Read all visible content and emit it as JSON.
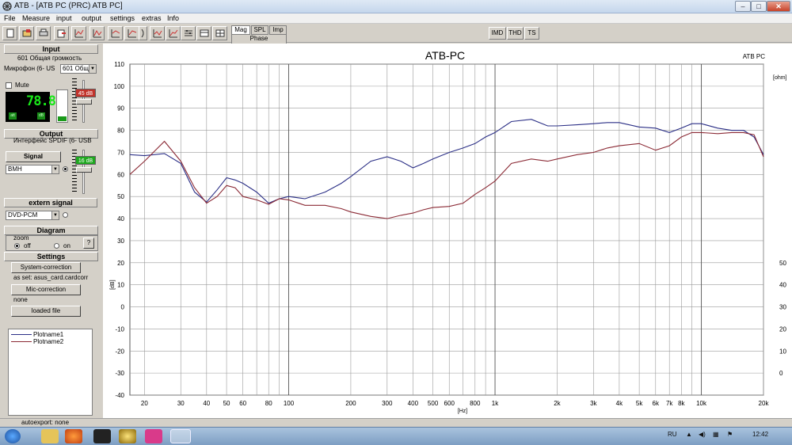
{
  "window": {
    "title": "ATB - [ATB PC (PRC)  ATB PC]",
    "buttons": {
      "minimize": "–",
      "maximize": "□",
      "close": "✕"
    }
  },
  "menu": {
    "items": [
      "File",
      "Measure",
      "input",
      "output",
      "settings",
      "extras",
      "Info"
    ]
  },
  "toolbar": {
    "icons": [
      "new-file-icon",
      "open-file-icon",
      "print-icon",
      "export-icon",
      "response-icon",
      "response-zoom-icon",
      "response-compare-icon",
      "response-overlay-icon",
      "phase-icon",
      "response-alt-icon",
      "response-extra-icon",
      "equalizer-icon",
      "settings-panel-icon",
      "grid-icon"
    ],
    "view_tabs": {
      "mag": "Mag",
      "spl": "SPL",
      "imp": "Imp",
      "phase": "Phase"
    },
    "right_buttons": {
      "imd": "IMD",
      "thd": "THD",
      "ts": "TS"
    }
  },
  "input": {
    "header": "Input",
    "device_name": "601 Общая громкость",
    "mic_label": "Микрофон (6- US",
    "combo": "601 Общ",
    "mute_label": "Mute",
    "level": "78.8",
    "gain": "45 dB",
    "lcd_left": "att",
    "lcd_right": "dB"
  },
  "output": {
    "header": "Output",
    "device_name": "Интерфейс SPDIF (6- USB",
    "level": "16 dB"
  },
  "signal": {
    "header": "Signal",
    "selected": "BMH"
  },
  "extern_signal": {
    "header": "extern signal",
    "selected": "DVD-PCM"
  },
  "diagram": {
    "header": "Diagram",
    "zoom_label": "zoom",
    "off_label": "off",
    "on_label": "on",
    "help_label": "?"
  },
  "settings": {
    "header": "Settings",
    "system_correction": "System-correction",
    "as_set": "as set: asus_card.cardcorr",
    "mic_correction": "Mic-correction",
    "mic_value": "none",
    "loaded_file": "loaded file"
  },
  "legend": [
    {
      "name": "Plotname1",
      "color": "#2b2f86"
    },
    {
      "name": "Plotname2",
      "color": "#8b2a35"
    }
  ],
  "status": {
    "text": "autoexport: none"
  },
  "taskbar": {
    "apps": [
      "start-orb-icon",
      "explorer-icon",
      "firefox-icon",
      "app-icon",
      "app2-icon",
      "app3-icon",
      "atb-icon"
    ],
    "lang": "RU",
    "time": "12:42"
  },
  "chart_data": {
    "type": "line",
    "title": "ATB-PC",
    "top_right_label": "ATB PC",
    "xlabel": "[Hz]",
    "ylabel": "[dB]",
    "y2label": "[ohm]",
    "x_scale": "log",
    "xlim": [
      17,
      20000
    ],
    "ylim": [
      -40,
      110
    ],
    "grid": true,
    "y_ticks": [
      110,
      100,
      90,
      80,
      70,
      60,
      50,
      40,
      30,
      20,
      10,
      0,
      -10,
      -20,
      -30,
      -40
    ],
    "y2_ticks": [
      50,
      40,
      30,
      20,
      10,
      0
    ],
    "y2_tick_values": [
      50,
      40,
      30,
      20,
      10,
      0
    ],
    "x_tick_labels": [
      {
        "x": 20,
        "label": "20"
      },
      {
        "x": 30,
        "label": "30"
      },
      {
        "x": 40,
        "label": "40"
      },
      {
        "x": 50,
        "label": "50"
      },
      {
        "x": 60,
        "label": "60"
      },
      {
        "x": 80,
        "label": "80"
      },
      {
        "x": 100,
        "label": "100"
      },
      {
        "x": 200,
        "label": "200"
      },
      {
        "x": 300,
        "label": "300"
      },
      {
        "x": 400,
        "label": "400"
      },
      {
        "x": 500,
        "label": "500"
      },
      {
        "x": 600,
        "label": "600"
      },
      {
        "x": 800,
        "label": "800"
      },
      {
        "x": 1000,
        "label": "1k"
      },
      {
        "x": 2000,
        "label": "2k"
      },
      {
        "x": 3000,
        "label": "3k"
      },
      {
        "x": 4000,
        "label": "4k"
      },
      {
        "x": 5000,
        "label": "5k"
      },
      {
        "x": 6000,
        "label": "6k"
      },
      {
        "x": 7000,
        "label": "7k"
      },
      {
        "x": 8000,
        "label": "8k"
      },
      {
        "x": 10000,
        "label": "10k"
      },
      {
        "x": 20000,
        "label": "20k"
      }
    ],
    "series": [
      {
        "name": "Plotname1",
        "color": "#2b2f86",
        "x": [
          17,
          20,
          25,
          30,
          35,
          40,
          45,
          50,
          55,
          60,
          70,
          80,
          90,
          100,
          120,
          150,
          180,
          200,
          250,
          300,
          350,
          400,
          450,
          500,
          600,
          700,
          800,
          900,
          1000,
          1200,
          1500,
          1800,
          2000,
          2500,
          3000,
          3500,
          4000,
          5000,
          6000,
          7000,
          8000,
          9000,
          10000,
          12000,
          14000,
          16000,
          18000,
          20000
        ],
        "y": [
          69,
          68.5,
          69.5,
          65,
          52,
          47.5,
          53,
          58.5,
          57.5,
          56,
          52,
          47,
          49,
          50,
          49,
          52,
          56,
          59,
          66,
          68,
          66,
          63,
          65,
          67,
          70,
          72,
          74,
          77,
          79,
          84,
          85,
          82,
          82,
          82.5,
          83,
          83.5,
          83.5,
          81.5,
          81,
          79,
          81,
          83,
          83,
          81,
          80,
          80,
          77,
          69
        ]
      },
      {
        "name": "Plotname2",
        "color": "#8b2a35",
        "x": [
          17,
          20,
          25,
          30,
          35,
          40,
          45,
          50,
          55,
          60,
          70,
          80,
          90,
          100,
          120,
          150,
          180,
          200,
          250,
          300,
          350,
          400,
          450,
          500,
          600,
          700,
          800,
          900,
          1000,
          1200,
          1500,
          1800,
          2000,
          2500,
          3000,
          3500,
          4000,
          5000,
          6000,
          7000,
          8000,
          9000,
          10000,
          12000,
          14000,
          16000,
          18000,
          20000
        ],
        "y": [
          60,
          66,
          75,
          66,
          54,
          47,
          50,
          55,
          54,
          50,
          48.5,
          46.5,
          49,
          48.5,
          46,
          46,
          44.5,
          43,
          41,
          40,
          41.5,
          42.5,
          44,
          45,
          45.5,
          47,
          51,
          54,
          57,
          65,
          67,
          66,
          67,
          69,
          70,
          72,
          73,
          74,
          71,
          73,
          77,
          79,
          79,
          78.5,
          79,
          79,
          78,
          68
        ]
      }
    ]
  }
}
